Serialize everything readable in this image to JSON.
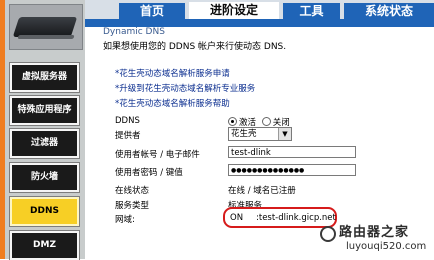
{
  "sidebar": {
    "items": [
      {
        "label": "虚拟服务器",
        "active": false
      },
      {
        "label": "特殊应用程序",
        "active": false
      },
      {
        "label": "过滤器",
        "active": false
      },
      {
        "label": "防火墙",
        "active": false
      },
      {
        "label": "DDNS",
        "active": true
      },
      {
        "label": "DMZ",
        "active": false
      }
    ]
  },
  "tabs": [
    {
      "label": "首页",
      "active": false
    },
    {
      "label": "进阶设定",
      "active": true
    },
    {
      "label": "工具",
      "active": false
    },
    {
      "label": "系统状态",
      "active": false
    }
  ],
  "main": {
    "section_title": "Dynamic DNS",
    "intro": "如果想使用您的 DDNS 帐户来行使动态 DNS.",
    "links": [
      "*花生壳动态域名解析服务申请",
      "*升级到花生壳动态域名解析专业服务",
      "*花生壳动态域名解析服务帮助"
    ],
    "ddns_label": "DDNS",
    "ddns_enable_label": "激活",
    "ddns_disable_label": "关闭",
    "provider_label": "提供者",
    "provider_value": "花生壳",
    "account_label": "使用者帐号 / 电子邮件",
    "account_value": "test-dlink",
    "password_label": "使用者密码 / 键值",
    "password_value": "●●●●●●●●●●●●●●",
    "online_status_label": "在线状态",
    "online_status_value": "在线 / 域名已注册",
    "service_type_label": "服务类型",
    "service_type_value": "标准服务",
    "domain_label": "网域:",
    "domain_status": "ON",
    "domain_value": ":test-dlink.gicp.net"
  },
  "watermark": {
    "text": "路由器之家",
    "url": "luyouqi520.com"
  },
  "colors": {
    "accent_orange": "#ef7d20",
    "tab_blue": "#1f64b7",
    "active_nav_yellow": "#f7cf25",
    "highlight_red": "#d61b1b"
  }
}
